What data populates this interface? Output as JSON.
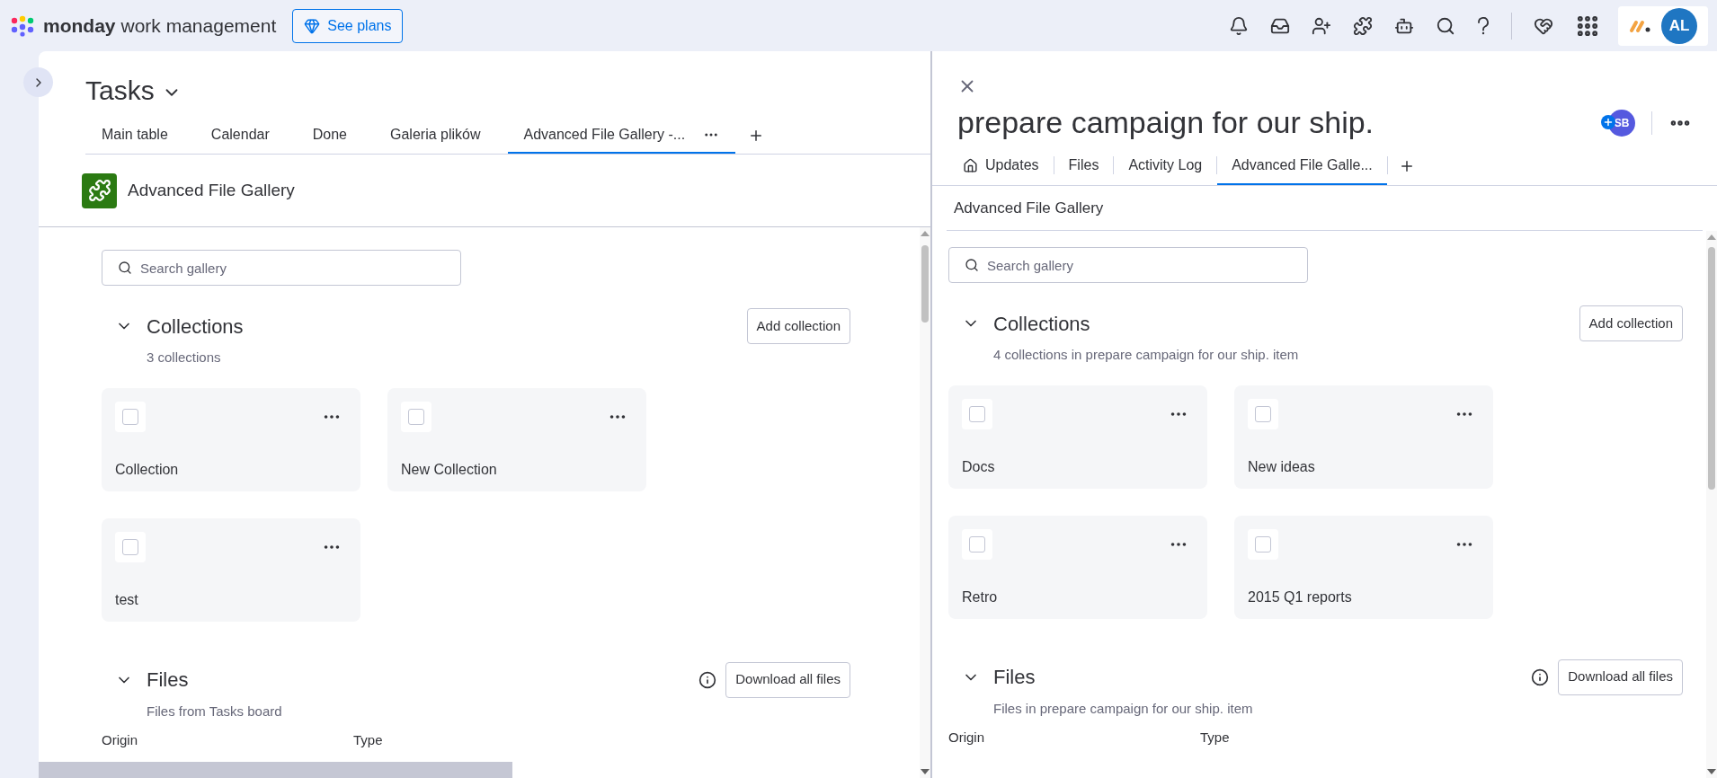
{
  "topbar": {
    "brand": "monday",
    "product": "work management",
    "upgrade_button": "See plans",
    "avatar": "AL"
  },
  "board": {
    "title": "Tasks",
    "tabs": [
      {
        "label": "Main table",
        "selected": false
      },
      {
        "label": "Calendar",
        "selected": false
      },
      {
        "label": "Done",
        "selected": false
      },
      {
        "label": "Galeria plików",
        "selected": false
      },
      {
        "label": "Advanced File Gallery -...",
        "selected": true
      }
    ],
    "view": {
      "title": "Advanced File Gallery",
      "search": {
        "placeholder": "Search gallery"
      },
      "collections": {
        "title": "Collections",
        "subtitle": "3 collections",
        "add_button": "Add collection",
        "items": [
          {
            "name": "Collection",
            "checked": false
          },
          {
            "name": "New Collection",
            "checked": false
          },
          {
            "name": "test",
            "checked": false
          }
        ]
      },
      "files": {
        "title": "Files",
        "subtitle": "Files from Tasks board",
        "download_button": "Download all files",
        "columns": [
          "Origin",
          "Type"
        ]
      }
    }
  },
  "item_panel": {
    "title": "prepare campaign for our ship.",
    "avatar": "SB",
    "tabs": [
      {
        "label": "Updates",
        "selected": false
      },
      {
        "label": "Files",
        "selected": false
      },
      {
        "label": "Activity Log",
        "selected": false
      },
      {
        "label": "Advanced File Galle...",
        "selected": true
      }
    ],
    "view": {
      "title": "Advanced File Gallery",
      "search": {
        "placeholder": "Search gallery"
      },
      "collections": {
        "title": "Collections",
        "subtitle": "4 collections in prepare campaign for our ship. item",
        "add_button": "Add collection",
        "items": [
          {
            "name": "Docs",
            "checked": false
          },
          {
            "name": "New ideas",
            "checked": false
          },
          {
            "name": "Retro",
            "checked": false
          },
          {
            "name": "2015 Q1 reports",
            "checked": false
          }
        ]
      },
      "files": {
        "title": "Files",
        "subtitle": "Files in prepare campaign for our ship. item",
        "download_button": "Download all files",
        "columns": [
          "Origin",
          "Type"
        ]
      }
    }
  }
}
